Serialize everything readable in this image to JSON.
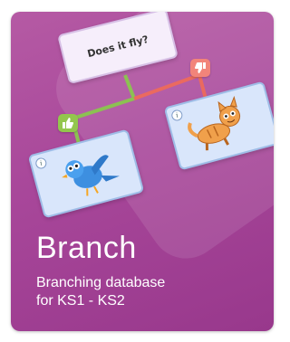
{
  "tile": {
    "title": "Branch",
    "subtitle_line1": "Branching database",
    "subtitle_line2": "for KS1 - KS2",
    "background_color": "#a8479a"
  },
  "diagram": {
    "question": "Does it fly?",
    "yes_icon": "thumbs-up-icon",
    "no_icon": "thumbs-down-icon",
    "yes_color": "#93c64d",
    "no_color": "#f2847a",
    "line_yes_color": "#8cc152",
    "line_no_color": "#ea6a5f",
    "card_bird": {
      "info": "i",
      "image": "blue-bird-illustration"
    },
    "card_cat": {
      "info": "i",
      "image": "orange-cat-illustration"
    }
  }
}
